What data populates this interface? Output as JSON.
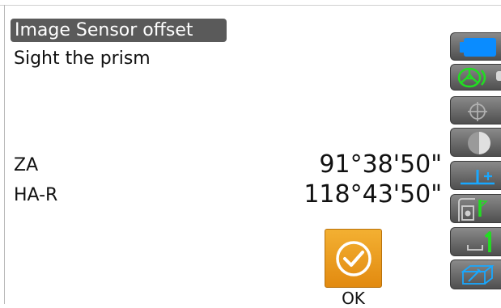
{
  "screen": {
    "title": "Image Sensor offset",
    "instruction": "Sight the prism"
  },
  "measurements": [
    {
      "label": "ZA",
      "value": "91°38'50\""
    },
    {
      "label": "HA-R",
      "value": "118°43'50\""
    }
  ],
  "ok_button": {
    "label": "OK",
    "icon": "checkmark-circle-icon"
  },
  "side_toolbar": [
    {
      "name": "battery",
      "icon": "battery-icon",
      "color": "#0a8cff"
    },
    {
      "name": "target-prism",
      "icon": "prism-target-icon",
      "color": "#22dd22"
    },
    {
      "name": "laser-pointer",
      "icon": "crosshair-icon",
      "color": "#b0b0b0"
    },
    {
      "name": "illumination",
      "icon": "half-circle-icon",
      "color": "#c8c8c8"
    },
    {
      "name": "tilt",
      "icon": "tilt-plus-icon",
      "color": "#18a8ff"
    },
    {
      "name": "edm-mode",
      "icon": "prism-edm-icon",
      "color": "#22dd22"
    },
    {
      "name": "interface",
      "icon": "interface-one-icon",
      "color": "#22dd22"
    },
    {
      "name": "input-mode",
      "icon": "keyboard-pen-icon",
      "color": "#18a8ff"
    }
  ],
  "colors": {
    "title_bg": "#5a5a5a",
    "ok_orange": "#e8971c",
    "side_button_gray": "#6a6a6a"
  }
}
